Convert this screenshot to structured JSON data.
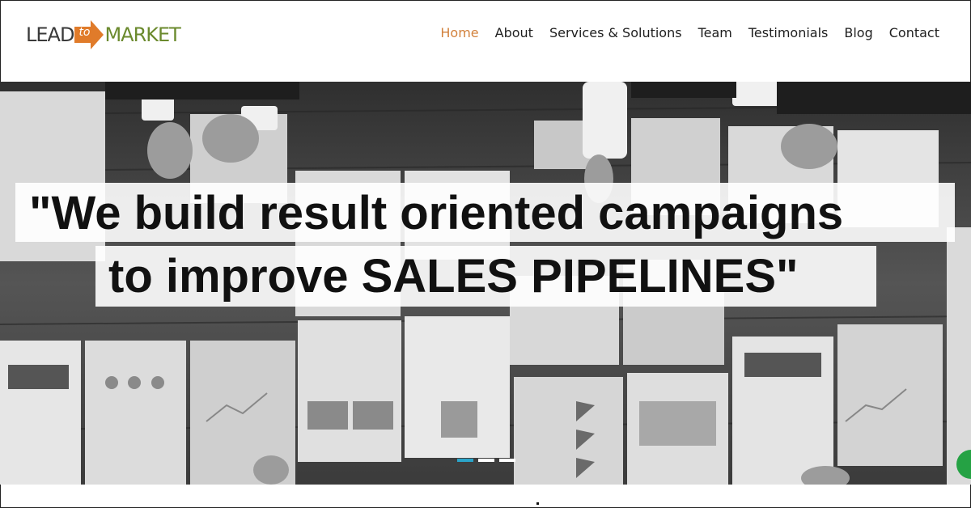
{
  "brand": {
    "logo_lead": "LEAD",
    "logo_to": "to",
    "logo_market": "MARKET",
    "lead_color": "#3a3a3a",
    "arrow_color": "#e07b2a",
    "market_color": "#6b8a2e"
  },
  "nav": {
    "items": [
      {
        "label": "Home",
        "active": true
      },
      {
        "label": "About"
      },
      {
        "label": "Services & Solutions"
      },
      {
        "label": "Team"
      },
      {
        "label": "Testimonials"
      },
      {
        "label": "Blog"
      },
      {
        "label": "Contact"
      }
    ],
    "active_color": "#d2813c"
  },
  "hero": {
    "quote_line1": "\"We build result oriented campaigns",
    "quote_line2": "to improve SALES PIPELINES\"",
    "slides": {
      "count": 3,
      "active_index": 1
    },
    "active_dot_color": "#2ba4c9",
    "chat_icon": "chat-bubble-icon",
    "chat_color": "#25a244"
  }
}
